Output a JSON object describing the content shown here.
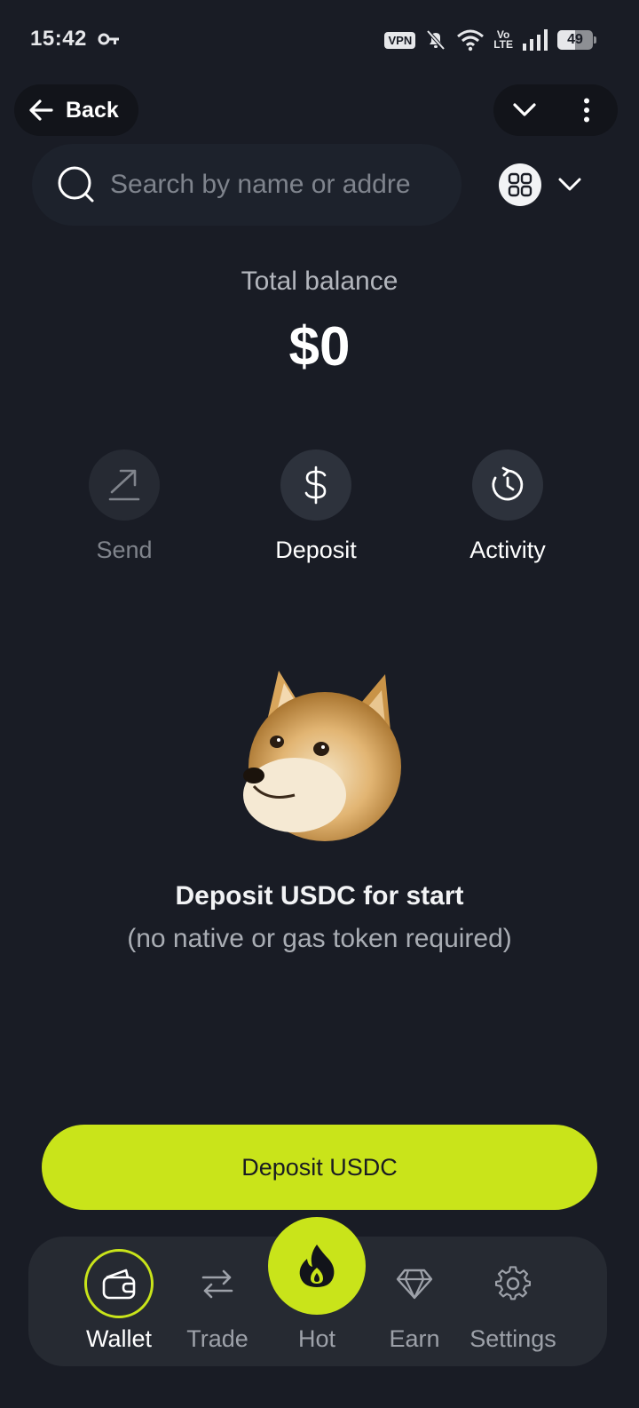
{
  "status_bar": {
    "time": "15:42",
    "vpn": "VPN",
    "volte_top": "Vo",
    "volte_bottom": "LTE",
    "battery": "49",
    "battery_level": 0.49
  },
  "top_nav": {
    "back_label": "Back"
  },
  "search": {
    "placeholder": "Search by name or addre"
  },
  "balance": {
    "label": "Total balance",
    "value": "$0"
  },
  "actions": [
    {
      "label": "Send",
      "icon": "send-arrow-icon",
      "enabled": false
    },
    {
      "label": "Deposit",
      "icon": "dollar-icon",
      "enabled": true
    },
    {
      "label": "Activity",
      "icon": "history-icon",
      "enabled": true
    }
  ],
  "empty_state": {
    "title": "Deposit USDC for start",
    "subtitle": "(no native or gas token required)"
  },
  "cta": {
    "label": "Deposit USDC"
  },
  "bottom_nav": {
    "items": [
      {
        "label": "Wallet",
        "icon": "wallet-icon",
        "active": true
      },
      {
        "label": "Trade",
        "icon": "swap-icon",
        "active": false
      },
      {
        "label": "Hot",
        "icon": "flame-icon",
        "active": false
      },
      {
        "label": "Earn",
        "icon": "diamond-icon",
        "active": false
      },
      {
        "label": "Settings",
        "icon": "gear-icon",
        "active": false
      }
    ]
  },
  "colors": {
    "background": "#191c25",
    "accent": "#c9e41a",
    "surface": "#262a32"
  }
}
